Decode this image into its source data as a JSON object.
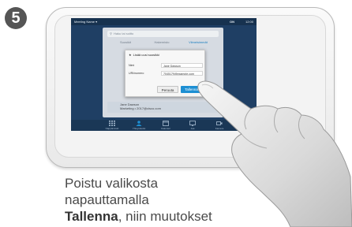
{
  "step_number": "5",
  "colors": {
    "accent": "#1d8fd3",
    "screen_bg": "#1f3f64",
    "badge": "#555555"
  },
  "screen": {
    "status_left": "Meeting Name ▾",
    "status_mid": "ON",
    "status_right": "12:00",
    "search_placeholder": "Haku tai soitto",
    "search_icon": "search-icon",
    "tabs": [
      "Suosikit",
      "Hakemisto",
      "Viimeisimmät"
    ],
    "contact_name": "Jane Dawson",
    "contact_detail": "Marketing • 2017@cisco.com"
  },
  "dialog": {
    "title": "Lisää uusi suosikki",
    "star_icon": "star-icon",
    "fields": [
      {
        "label": "Nimi",
        "value": "Jane Dawson"
      },
      {
        "label": "URI/numero",
        "value": "7045179@example.com"
      }
    ],
    "cancel_label": "Peruuta",
    "save_label": "Tallenna"
  },
  "dock": [
    {
      "label": "Näppäimistö",
      "icon": "keypad-icon"
    },
    {
      "label": "Yhteystiedot",
      "icon": "contacts-icon"
    },
    {
      "label": "Kalenteri",
      "icon": "calendar-icon"
    },
    {
      "label": "Jaa",
      "icon": "share-icon"
    },
    {
      "label": "Kamera",
      "icon": "camera-icon"
    }
  ],
  "caption": {
    "line1": "Poistu valikosta",
    "line2": "napauttamalla",
    "line3_bold": "Tallenna",
    "line3_rest": ", niin muutokset"
  }
}
